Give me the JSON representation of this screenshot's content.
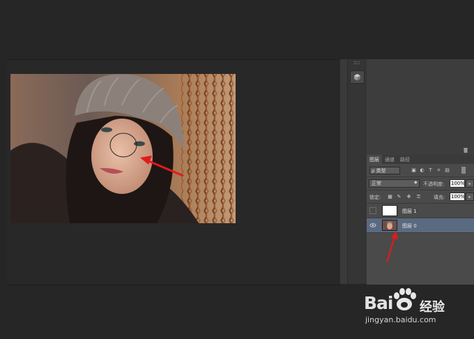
{
  "layers_panel": {
    "tabs": [
      "图层",
      "通道",
      "路径"
    ],
    "filter_kind": "ρ 类型",
    "blend_mode": "正常",
    "opacity_label": "不透明度:",
    "opacity_value": "100%",
    "lock_label": "锁定:",
    "fill_label": "填充:",
    "fill_value": "100%",
    "layers": [
      {
        "name": "图层 1",
        "visible": false,
        "selected": false
      },
      {
        "name": "图层 0",
        "visible": true,
        "selected": true
      }
    ]
  },
  "icons": {
    "cube": "cube-icon",
    "trash": "trash-icon",
    "eye": "eye-icon"
  },
  "watermark": {
    "brand_left": "Bai",
    "brand_right": "经验",
    "url": "jingyan.baidu.com"
  },
  "colors": {
    "annotation_arrow": "#e01b1b",
    "selected_layer": "#5a6a80",
    "background": "#262626"
  }
}
